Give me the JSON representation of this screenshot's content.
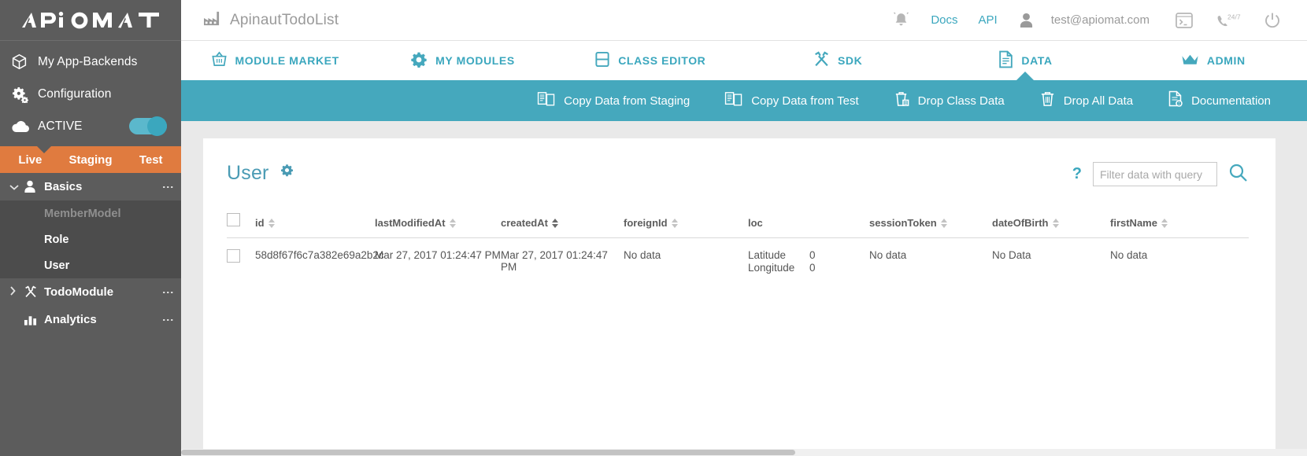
{
  "brand": {
    "logo_text": "APIOMAT",
    "accent_teal": "#45a8bd",
    "accent_orange": "#e07b3f",
    "sidebar_gray": "#5c5c5c"
  },
  "sidebar": {
    "items": [
      {
        "label": "My App-Backends",
        "icon": "cube-icon"
      },
      {
        "label": "Configuration",
        "icon": "gears-icon"
      },
      {
        "label": "ACTIVE",
        "icon": "cloud-icon",
        "toggle": "on"
      }
    ],
    "environments": [
      {
        "label": "Live",
        "active": true
      },
      {
        "label": "Staging",
        "active": false
      },
      {
        "label": "Test",
        "active": false
      }
    ],
    "tree": [
      {
        "label": "Basics",
        "icon": "person-icon",
        "expanded": true,
        "children": [
          {
            "label": "MemberModel",
            "state": "muted"
          },
          {
            "label": "Role",
            "state": "normal"
          },
          {
            "label": "User",
            "state": "selected"
          }
        ]
      },
      {
        "label": "TodoModule",
        "icon": "tools-icon",
        "expanded": false,
        "children": []
      },
      {
        "label": "Analytics",
        "icon": "chart-icon",
        "expanded": null,
        "children": []
      }
    ]
  },
  "topbar": {
    "project_icon": "factory-icon",
    "project_title": "ApinautTodoList",
    "bell_icon": "bell-icon",
    "docs_label": "Docs",
    "api_label": "API",
    "user_icon": "person-icon",
    "user_email": "test@apiomat.com",
    "terminal_icon": "terminal-icon",
    "support_icon": "phone-24-7-icon",
    "support_label": "24/7",
    "power_icon": "power-icon"
  },
  "modnav": [
    {
      "label": "MODULE MARKET",
      "icon": "basket-icon",
      "active": false
    },
    {
      "label": "MY MODULES",
      "icon": "gear-icon",
      "active": false
    },
    {
      "label": "CLASS EDITOR",
      "icon": "class-editor-icon",
      "active": false
    },
    {
      "label": "SDK",
      "icon": "tools-icon",
      "active": false
    },
    {
      "label": "DATA",
      "icon": "document-icon",
      "active": true
    },
    {
      "label": "ADMIN",
      "icon": "crown-icon",
      "active": false
    }
  ],
  "actionbar": [
    {
      "label": "Copy Data from Staging",
      "icon": "copy-icon"
    },
    {
      "label": "Copy Data from Test",
      "icon": "copy-icon"
    },
    {
      "label": "Drop Class Data",
      "icon": "trash-class-icon"
    },
    {
      "label": "Drop All Data",
      "icon": "trash-icon"
    },
    {
      "label": "Documentation",
      "icon": "doc-help-icon"
    }
  ],
  "panel": {
    "title": "User",
    "settings_icon": "gear-icon",
    "help_label": "?",
    "filter_placeholder": "Filter data with query",
    "filter_value": "",
    "search_icon": "search-icon"
  },
  "table": {
    "columns": [
      {
        "key": "id",
        "label": "id",
        "sortable": true,
        "sort_active": false
      },
      {
        "key": "lastModifiedAt",
        "label": "lastModifiedAt",
        "sortable": true,
        "sort_active": false
      },
      {
        "key": "createdAt",
        "label": "createdAt",
        "sortable": true,
        "sort_active": true
      },
      {
        "key": "foreignId",
        "label": "foreignId",
        "sortable": true,
        "sort_active": false
      },
      {
        "key": "loc",
        "label": "loc",
        "sortable": false,
        "sort_active": false
      },
      {
        "key": "sessionToken",
        "label": "sessionToken",
        "sortable": true,
        "sort_active": false
      },
      {
        "key": "dateOfBirth",
        "label": "dateOfBirth",
        "sortable": true,
        "sort_active": false
      },
      {
        "key": "firstName",
        "label": "firstName",
        "sortable": true,
        "sort_active": false
      }
    ],
    "rows": [
      {
        "id": "58d8f67f6c7a382e69a2b2c",
        "lastModifiedAt": "Mar 27, 2017 01:24:47 PM",
        "createdAt": "Mar 27, 2017 01:24:47 PM",
        "foreignId": "No data",
        "loc": {
          "latitude_label": "Latitude",
          "latitude_value": "0",
          "longitude_label": "Longitude",
          "longitude_value": "0"
        },
        "sessionToken": "No data",
        "dateOfBirth": "No Data",
        "firstName": "No data"
      }
    ]
  }
}
